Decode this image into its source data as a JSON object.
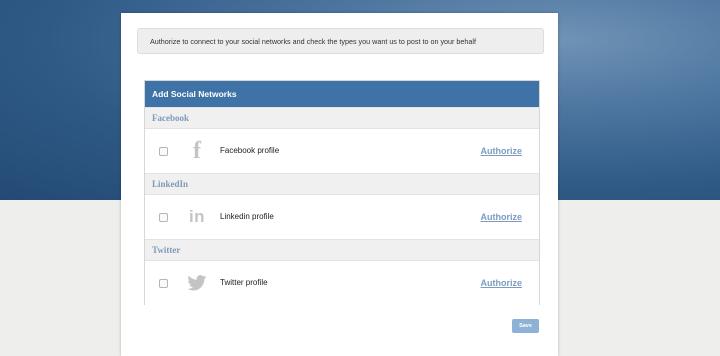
{
  "notice": {
    "text": "Authorize to connect to your social networks and check the types you want us to post to on your behalf"
  },
  "card": {
    "title": "Add Social Networks",
    "sections": [
      {
        "title": "Facebook",
        "icon": "facebook-icon",
        "profile_label": "Facebook profile",
        "action_label": "Authorize"
      },
      {
        "title": "LinkedIn",
        "icon": "linkedin-icon",
        "profile_label": "Linkedin profile",
        "action_label": "Authorize"
      },
      {
        "title": "Twitter",
        "icon": "twitter-icon",
        "profile_label": "Twitter profile",
        "action_label": "Authorize"
      }
    ]
  },
  "save_label": "Save",
  "colors": {
    "header_blue": "#3f73a8",
    "link_blue": "#7c9cbf",
    "save_button": "#8eb1d6"
  }
}
